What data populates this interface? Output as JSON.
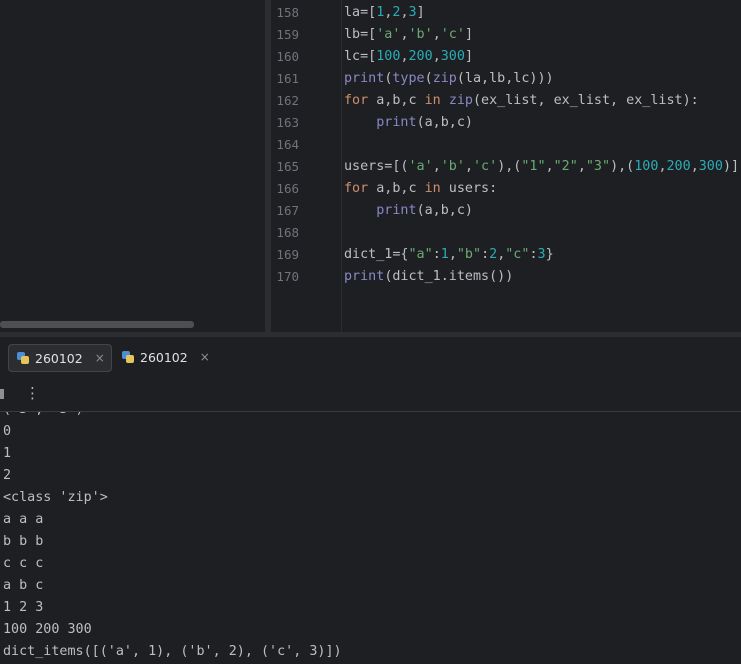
{
  "editor": {
    "lines": [
      {
        "n": "158",
        "tokens": [
          {
            "t": "la=[",
            "c": ""
          },
          {
            "t": "1",
            "c": "num"
          },
          {
            "t": ",",
            "c": ""
          },
          {
            "t": "2",
            "c": "num"
          },
          {
            "t": ",",
            "c": ""
          },
          {
            "t": "3",
            "c": "num"
          },
          {
            "t": "]",
            "c": ""
          }
        ]
      },
      {
        "n": "159",
        "tokens": [
          {
            "t": "lb=[",
            "c": ""
          },
          {
            "t": "'a'",
            "c": "str"
          },
          {
            "t": ",",
            "c": ""
          },
          {
            "t": "'b'",
            "c": "str"
          },
          {
            "t": ",",
            "c": ""
          },
          {
            "t": "'c'",
            "c": "str"
          },
          {
            "t": "]",
            "c": ""
          }
        ]
      },
      {
        "n": "160",
        "tokens": [
          {
            "t": "lc=[",
            "c": ""
          },
          {
            "t": "100",
            "c": "num"
          },
          {
            "t": ",",
            "c": ""
          },
          {
            "t": "200",
            "c": "num"
          },
          {
            "t": ",",
            "c": ""
          },
          {
            "t": "300",
            "c": "num"
          },
          {
            "t": "]",
            "c": ""
          }
        ]
      },
      {
        "n": "161",
        "tokens": [
          {
            "t": "print",
            "c": "fn"
          },
          {
            "t": "(",
            "c": ""
          },
          {
            "t": "type",
            "c": "fn"
          },
          {
            "t": "(",
            "c": ""
          },
          {
            "t": "zip",
            "c": "fn"
          },
          {
            "t": "(la,lb,lc)))",
            "c": ""
          }
        ]
      },
      {
        "n": "162",
        "tokens": [
          {
            "t": "for",
            "c": "kw"
          },
          {
            "t": " a,b,c ",
            "c": ""
          },
          {
            "t": "in",
            "c": "kw"
          },
          {
            "t": " ",
            "c": ""
          },
          {
            "t": "zip",
            "c": "fn"
          },
          {
            "t": "(ex_list, ex_list, ex_list):",
            "c": ""
          }
        ]
      },
      {
        "n": "163",
        "tokens": [
          {
            "t": "    ",
            "c": ""
          },
          {
            "t": "print",
            "c": "fn"
          },
          {
            "t": "(a,b,c)",
            "c": ""
          }
        ]
      },
      {
        "n": "164",
        "tokens": []
      },
      {
        "n": "165",
        "tokens": [
          {
            "t": "users=[(",
            "c": ""
          },
          {
            "t": "'a'",
            "c": "str"
          },
          {
            "t": ",",
            "c": ""
          },
          {
            "t": "'b'",
            "c": "str"
          },
          {
            "t": ",",
            "c": ""
          },
          {
            "t": "'c'",
            "c": "str"
          },
          {
            "t": "),(",
            "c": ""
          },
          {
            "t": "\"1\"",
            "c": "str"
          },
          {
            "t": ",",
            "c": ""
          },
          {
            "t": "\"2\"",
            "c": "str"
          },
          {
            "t": ",",
            "c": ""
          },
          {
            "t": "\"3\"",
            "c": "str"
          },
          {
            "t": "),(",
            "c": ""
          },
          {
            "t": "100",
            "c": "num"
          },
          {
            "t": ",",
            "c": ""
          },
          {
            "t": "200",
            "c": "num"
          },
          {
            "t": ",",
            "c": ""
          },
          {
            "t": "300",
            "c": "num"
          },
          {
            "t": ")]",
            "c": ""
          }
        ]
      },
      {
        "n": "166",
        "tokens": [
          {
            "t": "for",
            "c": "kw"
          },
          {
            "t": " a,b,c ",
            "c": ""
          },
          {
            "t": "in",
            "c": "kw"
          },
          {
            "t": " users:",
            "c": ""
          }
        ]
      },
      {
        "n": "167",
        "tokens": [
          {
            "t": "    ",
            "c": ""
          },
          {
            "t": "print",
            "c": "fn"
          },
          {
            "t": "(a,b,c)",
            "c": ""
          }
        ]
      },
      {
        "n": "168",
        "tokens": []
      },
      {
        "n": "169",
        "tokens": [
          {
            "t": "dict_1={",
            "c": ""
          },
          {
            "t": "\"a\"",
            "c": "str"
          },
          {
            "t": ":",
            "c": ""
          },
          {
            "t": "1",
            "c": "num"
          },
          {
            "t": ",",
            "c": ""
          },
          {
            "t": "\"b\"",
            "c": "str"
          },
          {
            "t": ":",
            "c": ""
          },
          {
            "t": "2",
            "c": "num"
          },
          {
            "t": ",",
            "c": ""
          },
          {
            "t": "\"c\"",
            "c": "str"
          },
          {
            "t": ":",
            "c": ""
          },
          {
            "t": "3",
            "c": "num"
          },
          {
            "t": "}",
            "c": ""
          }
        ]
      },
      {
        "n": "170",
        "tokens": [
          {
            "t": "print",
            "c": "fn"
          },
          {
            "t": "(dict_1.items())",
            "c": ""
          }
        ]
      }
    ]
  },
  "run_tabs": [
    {
      "label": "260102",
      "active": true,
      "close": "×",
      "icon": "python-icon"
    },
    {
      "label": "260102",
      "active": false,
      "close": "×",
      "icon": "python-icon"
    }
  ],
  "toolbar": {
    "more_icon": "⋮"
  },
  "console": {
    "lines": [
      "0",
      "1",
      "2",
      "<class 'zip'>",
      "a a a",
      "b b b",
      "c c c",
      "a b c",
      "1 2 3",
      "100 200 300",
      "dict_items([('a', 1), ('b', 2), ('c', 3)])"
    ]
  },
  "colors": {
    "background": "#1e1f22",
    "keyword": "#cf8e6d",
    "builtin": "#8888c6",
    "number": "#2aacb8",
    "string": "#6aab73",
    "text": "#bcbec4"
  }
}
